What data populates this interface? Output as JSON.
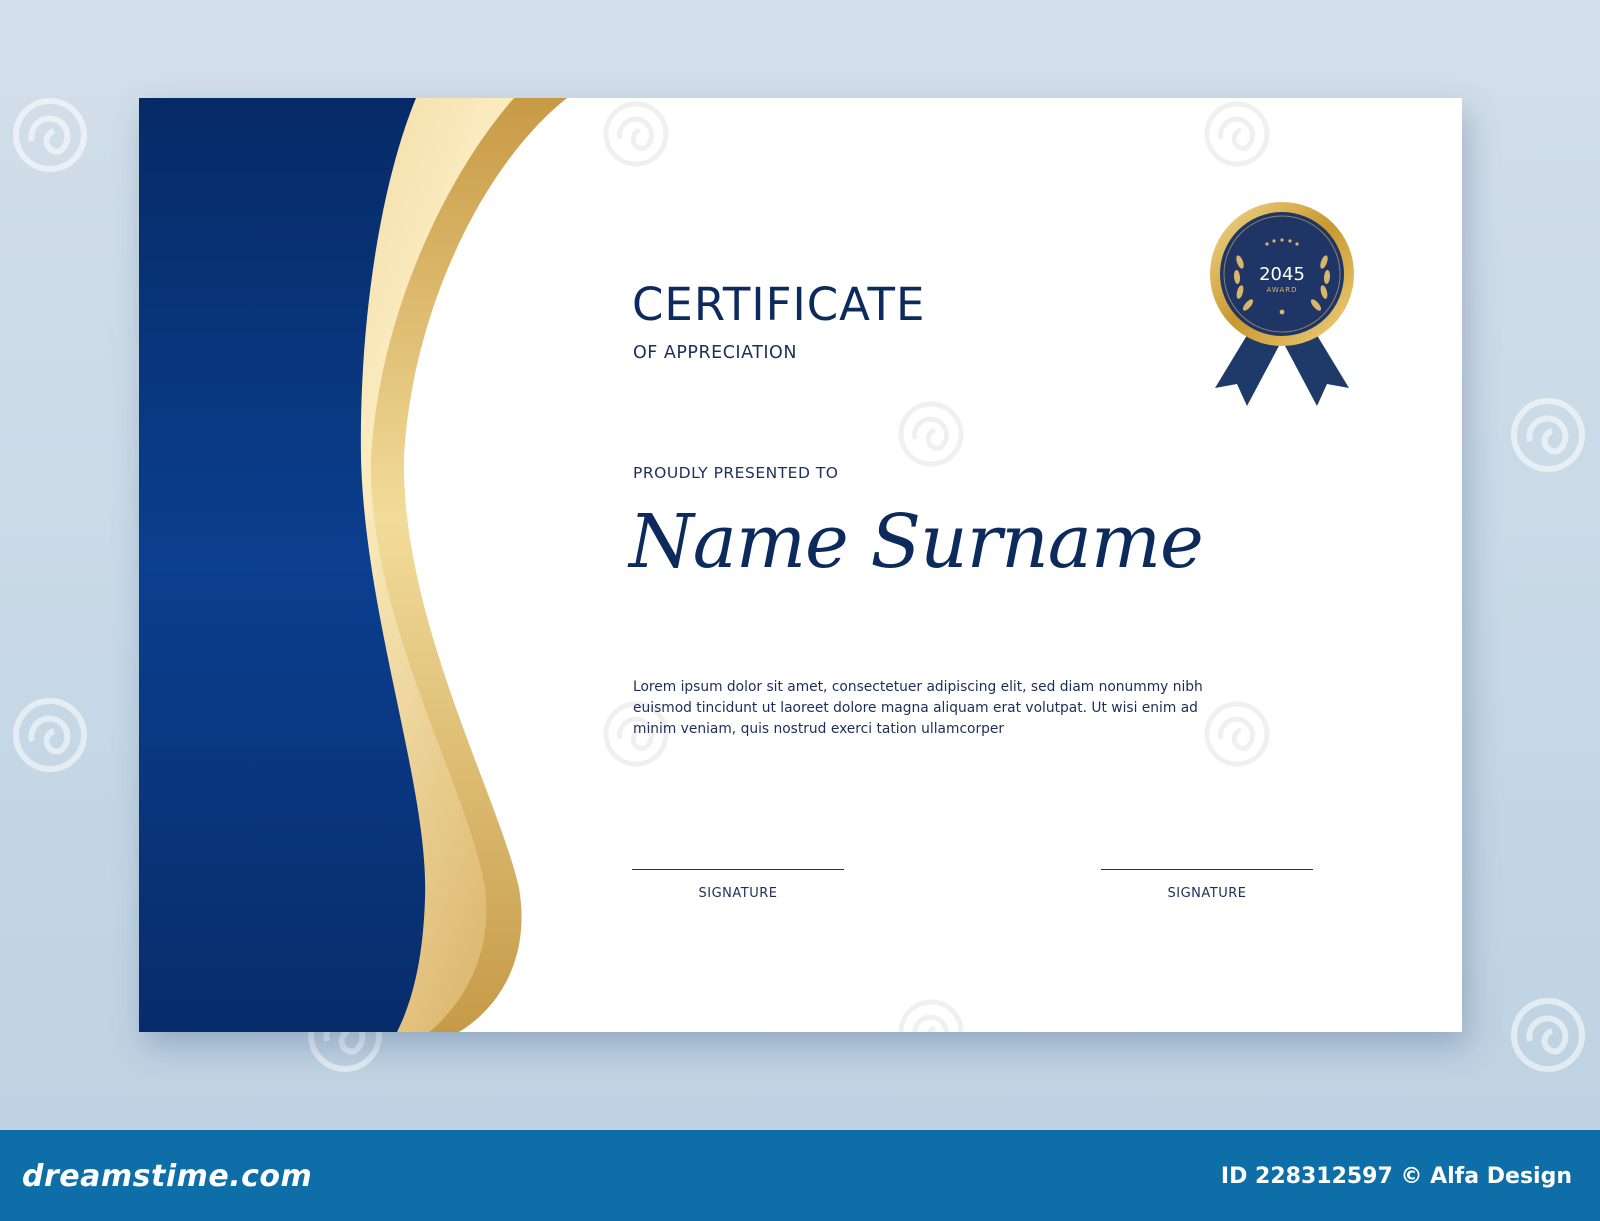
{
  "certificate": {
    "title": "CERTIFICATE",
    "subtitle": "OF APPRECIATION",
    "presented_label": "PROUDLY PRESENTED TO",
    "recipient_name": "Name Surname",
    "body": "Lorem ipsum dolor sit amet, consectetuer adipiscing elit, sed diam nonummy nibh euismod tincidunt ut laoreet dolore magna aliquam erat volutpat. Ut wisi enim ad minim veniam, quis nostrud exerci tation ullamcorper",
    "signatures": [
      {
        "label": "SIGNATURE"
      },
      {
        "label": "SIGNATURE"
      }
    ]
  },
  "badge": {
    "year": "2045",
    "label": "AWARD"
  },
  "watermark": {
    "text": "dreamstime"
  },
  "footer": {
    "logo": "dreamstime.com",
    "stock_id": "ID 228312597 © Alfa Design"
  },
  "colors": {
    "navy": "#0d2a5c",
    "royal_blue": "#0a3d8c",
    "gold": "#d9b569",
    "footer_blue": "#0e6fa8"
  }
}
